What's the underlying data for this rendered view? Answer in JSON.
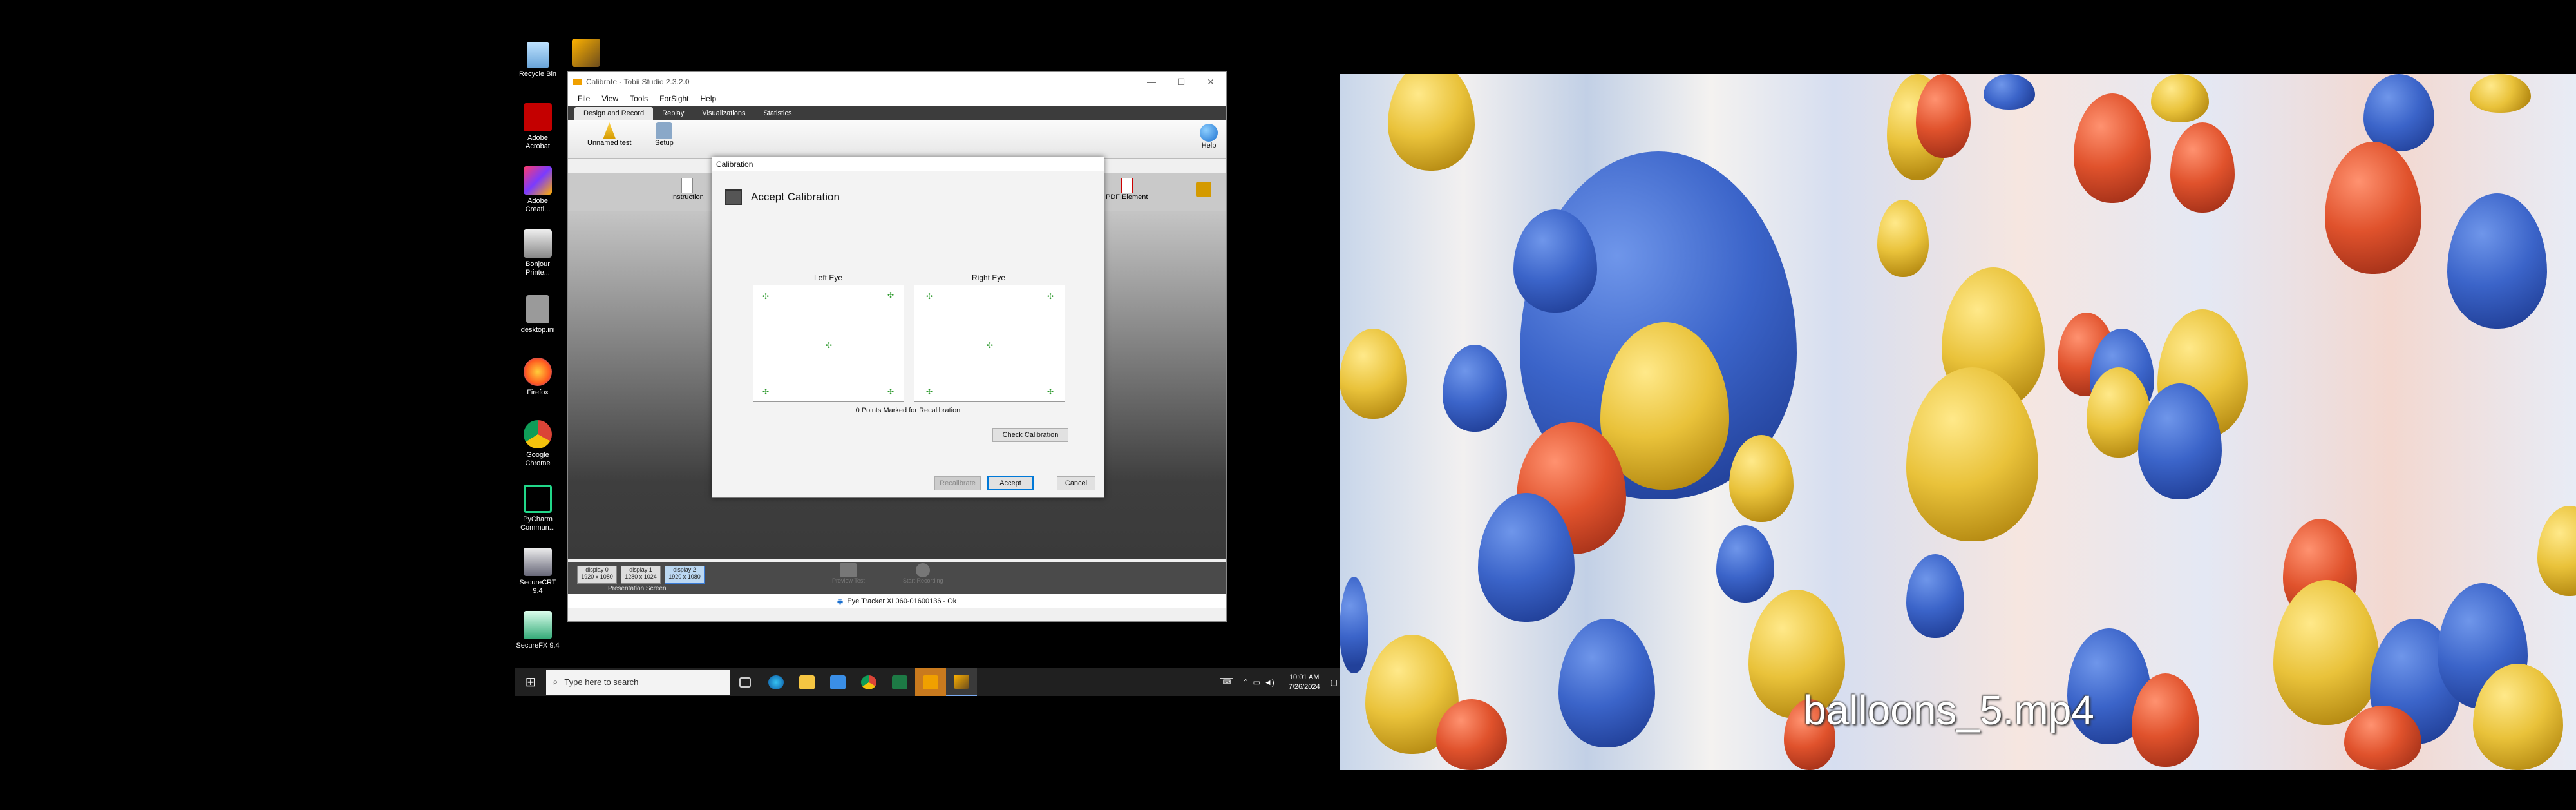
{
  "desktop": {
    "icons": [
      {
        "label": "Recycle Bin"
      },
      {
        "label": ""
      },
      {
        "label": "Adobe Acrobat"
      },
      {
        "label": "Adobe Creati..."
      },
      {
        "label": "Bonjour Printe..."
      },
      {
        "label": "desktop.ini"
      },
      {
        "label": "Firefox"
      },
      {
        "label": "Google Chrome"
      },
      {
        "label": "PyCharm Commun..."
      },
      {
        "label": "SecureCRT 9.4"
      },
      {
        "label": "SecureFX 9.4"
      }
    ]
  },
  "app": {
    "title": "Calibrate - Tobii Studio 2.3.2.0",
    "menu": [
      "File",
      "View",
      "Tools",
      "ForSight",
      "Help"
    ],
    "tabs": [
      "Design and Record",
      "Replay",
      "Visualizations",
      "Statistics"
    ],
    "ribbon": {
      "test_label": "Unnamed test",
      "setup_label": "Setup",
      "help_label": "Help"
    },
    "toolstrip": {
      "instruction_label": "Instruction",
      "pdf_label": "PDF Element"
    },
    "bottom": {
      "displays": [
        {
          "name": "display 0",
          "res": "1920 x 1080"
        },
        {
          "name": "display 1",
          "res": "1280 x 1024"
        },
        {
          "name": "display 2",
          "res": "1920 x 1080"
        }
      ],
      "presentation_label": "Presentation Screen",
      "preview_label": "Preview Test",
      "start_label": "Start Recording"
    },
    "status": "Eye Tracker XL060-01600136 - Ok"
  },
  "dialog": {
    "title": "Calibration",
    "heading": "Accept Calibration",
    "left_eye": "Left Eye",
    "right_eye": "Right Eye",
    "points_marked": "0 Points Marked for Recalibration",
    "check_button": "Check Calibration",
    "recalibrate_button": "Recalibrate",
    "accept_button": "Accept",
    "cancel_button": "Cancel"
  },
  "taskbar": {
    "search_placeholder": "Type here to search",
    "time": "10:01 AM",
    "date": "7/26/2024"
  },
  "video": {
    "caption": "balloons_5.mp4"
  }
}
